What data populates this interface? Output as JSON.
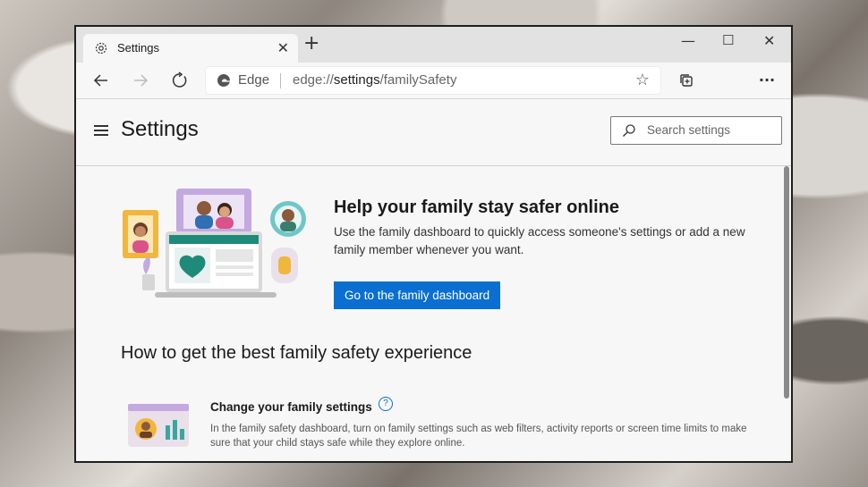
{
  "tab": {
    "title": "Settings",
    "close": "✕"
  },
  "window_controls": {
    "minimize": "—",
    "maximize": "☐",
    "close": "✕"
  },
  "new_tab": "+",
  "address_bar": {
    "edge_label": "Edge",
    "url_prefix": "edge://",
    "url_host": "settings",
    "url_path": "/familySafety"
  },
  "toolbar": {
    "more": "···"
  },
  "settings": {
    "title": "Settings",
    "search_placeholder": "Search settings"
  },
  "hero": {
    "title": "Help your family stay safer online",
    "description": "Use the family dashboard to quickly access someone's settings or add a new family member whenever you want.",
    "button": "Go to the family dashboard"
  },
  "section": {
    "title": "How to get the best family safety experience",
    "items": [
      {
        "title": "Change your family settings",
        "help": "?",
        "description": "In the family safety dashboard, turn on family settings such as web filters, activity reports or screen time limits to make sure that your child stays safe while they explore online."
      }
    ]
  },
  "colors": {
    "accent": "#0a6fd1",
    "frame_purple": "#c4a8e0",
    "frame_orange": "#f0b63e",
    "frame_teal": "#6fc6c6",
    "heart_green": "#1e8a7a"
  }
}
